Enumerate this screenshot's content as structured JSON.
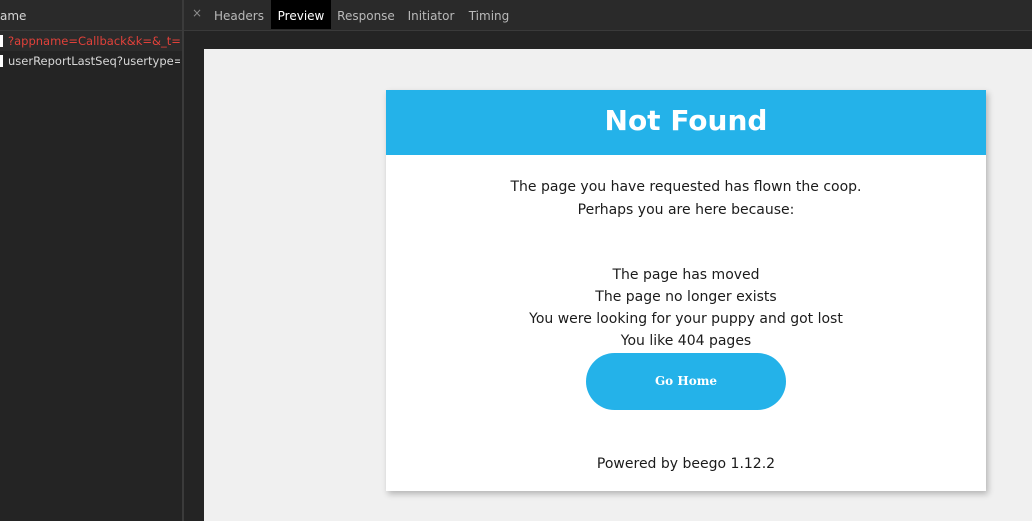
{
  "network_list": {
    "header": "ame",
    "requests": [
      {
        "name": "?appname=Callback&k=&_t=...",
        "status": "error"
      },
      {
        "name": "userReportLastSeq?usertype=...",
        "status": "ok"
      }
    ]
  },
  "details": {
    "close_icon": "×",
    "tabs": [
      "Headers",
      "Preview",
      "Response",
      "Initiator",
      "Timing"
    ],
    "active_tab": "Preview"
  },
  "preview": {
    "title": "Not Found",
    "intro_lines": [
      "The page you have requested has flown the coop.",
      "Perhaps you are here because:"
    ],
    "reasons": [
      "The page has moved",
      "The page no longer exists",
      "You were looking for your puppy and got lost",
      "You like 404 pages"
    ],
    "button_label": "Go Home",
    "footer": "Powered by beego 1.12.2"
  },
  "colors": {
    "accent": "#24b2e9",
    "error_text": "#e0413a",
    "panel_bg": "#242424",
    "active_tab_bg": "#000000"
  }
}
